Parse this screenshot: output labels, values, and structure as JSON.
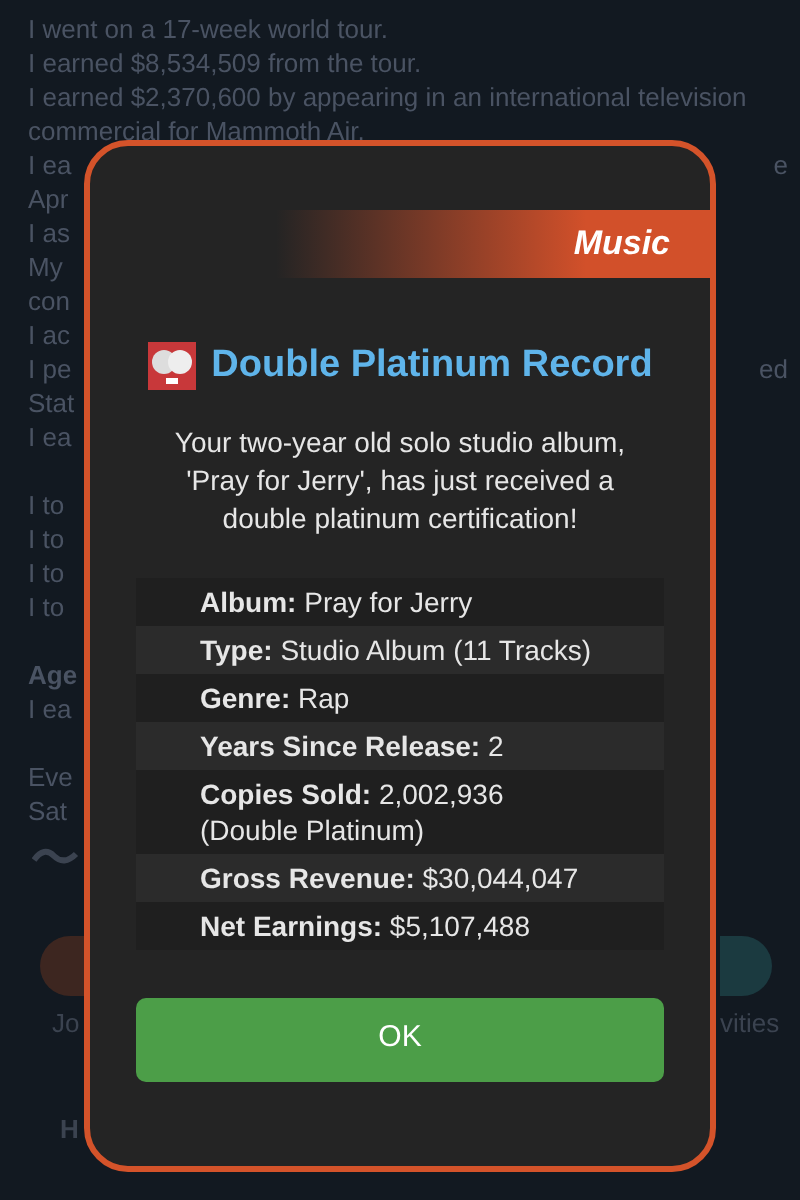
{
  "background": {
    "lines": [
      {
        "text": "I went on a 17-week world tour.",
        "kind": "plain"
      },
      {
        "text": "I earned $8,534,509 from the tour.",
        "kind": "plain"
      },
      {
        "text": "I earned $2,370,600 by appearing in an international television",
        "kind": "plain"
      },
      {
        "text": "commercial for Mammoth Air.",
        "kind": "plain"
      },
      {
        "text": "I ea",
        "right": "e",
        "kind": "plain"
      },
      {
        "text": "Apr",
        "kind": "plain"
      },
      {
        "text": "I as",
        "kind": "plain"
      },
      {
        "text": "My",
        "kind": "plain"
      },
      {
        "text": "con",
        "kind": "plain"
      },
      {
        "text": "I ac",
        "kind": "plain"
      },
      {
        "text": "I pe",
        "right": "ed",
        "kind": "plain"
      },
      {
        "text": "Stat",
        "kind": "plain"
      },
      {
        "text": "I ea",
        "kind": "plain"
      },
      {
        "kind": "gap"
      },
      {
        "text": "I to",
        "kind": "plain"
      },
      {
        "text": "I to",
        "kind": "plain"
      },
      {
        "text": "I to",
        "kind": "plain"
      },
      {
        "text": "I to",
        "kind": "plain"
      },
      {
        "kind": "gap"
      },
      {
        "text": "Age",
        "kind": "heading"
      },
      {
        "text": "I ea",
        "kind": "plain"
      },
      {
        "kind": "gap"
      },
      {
        "text": "Eve",
        "kind": "plain"
      },
      {
        "text": "Sat",
        "kind": "plain"
      }
    ],
    "nav_left": "Jo",
    "nav_right": "vities",
    "bottom_tab": "H"
  },
  "dialog": {
    "category": "Music",
    "title": "Double Platinum Record",
    "message": "Your two-year old solo studio album, 'Pray for Jerry', has just received a double platinum certification!",
    "details": [
      {
        "label": "Album:",
        "value": "Pray for Jerry"
      },
      {
        "label": "Type:",
        "value": "Studio Album (11 Tracks)"
      },
      {
        "label": "Genre:",
        "value": "Rap"
      },
      {
        "label": "Years Since Release:",
        "value": "2"
      },
      {
        "label": "Copies Sold:",
        "value": "2,002,936 (Double Platinum)"
      },
      {
        "label": "Gross Revenue:",
        "value": "$30,044,047"
      },
      {
        "label": "Net Earnings:",
        "value": "$5,107,488"
      }
    ],
    "button": "OK"
  }
}
